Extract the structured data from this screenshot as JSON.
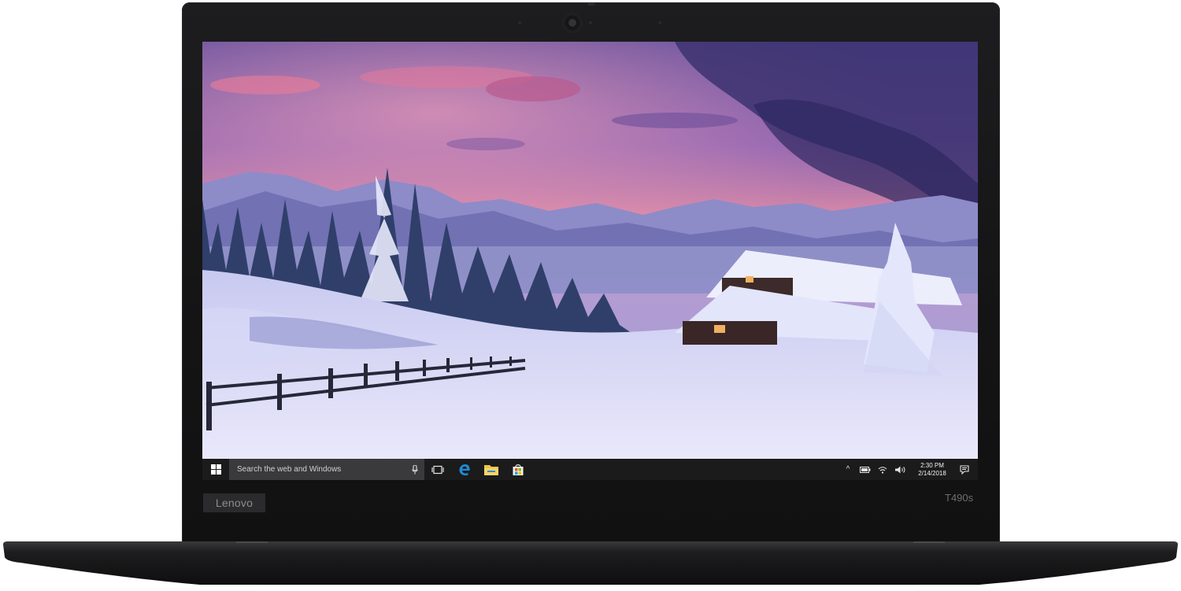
{
  "device": {
    "brand_logo": "Lenovo",
    "model": "T490s"
  },
  "taskbar": {
    "start_icon": "windows-logo-icon",
    "search": {
      "placeholder": "Search the web and Windows",
      "mic_icon": "microphone-icon"
    },
    "pinned": [
      {
        "name": "task-view-icon"
      },
      {
        "name": "edge-browser-icon"
      },
      {
        "name": "file-explorer-icon"
      },
      {
        "name": "store-icon"
      }
    ],
    "tray": {
      "chevron": "^",
      "icons": [
        "battery-icon",
        "wifi-icon",
        "volume-icon"
      ],
      "time": "2:30 PM",
      "date": "2/14/2018",
      "notification_icon": "action-center-icon"
    }
  },
  "colors": {
    "bezel": "#141415",
    "taskbar": "#1b1b1c",
    "search_box": "#3a3a3c",
    "accent_blue": "#1e8ad6"
  }
}
